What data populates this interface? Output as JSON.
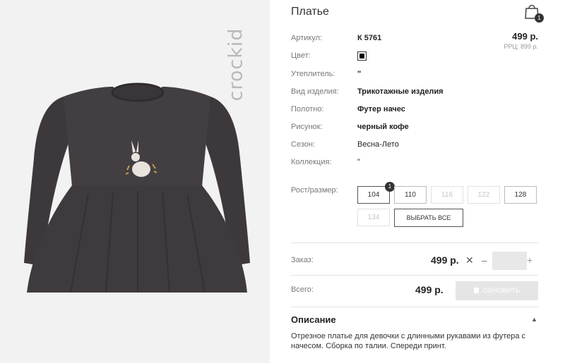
{
  "brand": {
    "logo_text": "crockid"
  },
  "product": {
    "title": "Платье",
    "price": "499 р.",
    "rrp": "РРЦ: 899 р."
  },
  "cart": {
    "count": "1"
  },
  "specs": [
    {
      "label": "Артикул:",
      "value": "К 5761"
    },
    {
      "label": "Цвет:",
      "value": ""
    },
    {
      "label": "Утеплитель:",
      "value": "\""
    },
    {
      "label": "Вид изделия:",
      "value": "Трикотажные изделия"
    },
    {
      "label": "Полотно:",
      "value": "Футер начес"
    },
    {
      "label": "Рисунок:",
      "value": "черный кофе"
    },
    {
      "label": "Сезон:",
      "value": "Весна-Лето"
    },
    {
      "label": "Коллекция:",
      "value": "\""
    }
  ],
  "color_swatch": "#000000",
  "sizes": {
    "label": "Рост/размер:",
    "items": [
      "104",
      "110",
      "116",
      "122",
      "128",
      "134"
    ],
    "selected_badge": "1",
    "select_all": "ВЫБРАТЬ ВСЕ"
  },
  "order": {
    "label": "Заказ:",
    "price": "499 р.",
    "times": "✕",
    "minus": "–",
    "plus": "+",
    "quantity": ""
  },
  "total": {
    "label": "Всего:",
    "price": "499 р.",
    "update_button": "ОБНОВИТЬ"
  },
  "description": {
    "title": "Описание",
    "caret": "▲",
    "text": "Отрезное платье для девочки с длинными рукавами из футера с начесом. Сборка по талии. Спереди принт."
  }
}
